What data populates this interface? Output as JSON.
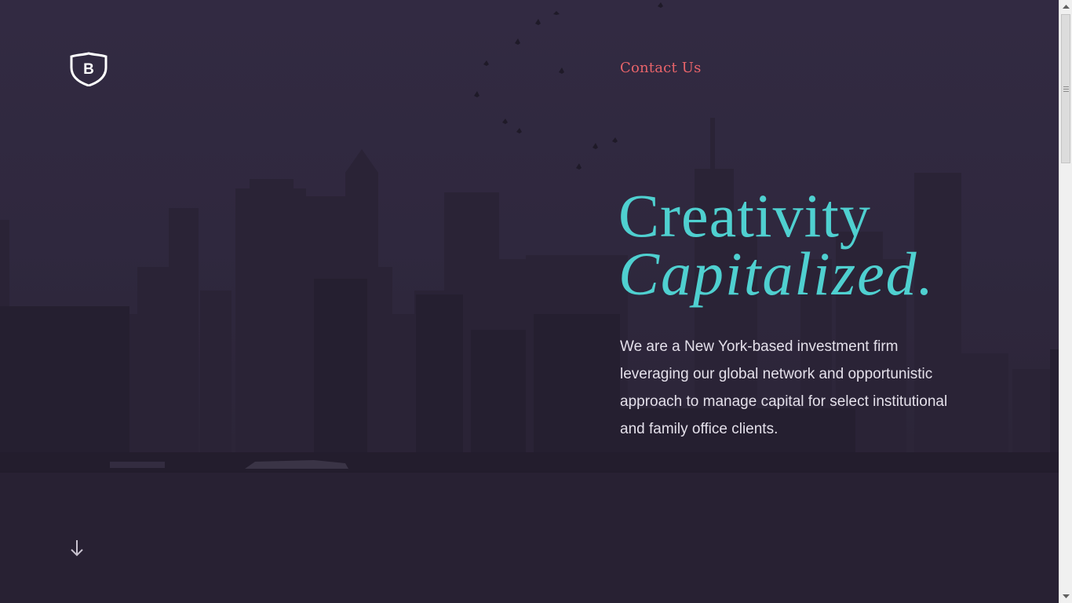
{
  "header": {
    "logo_letter": "B",
    "logo_icon": "shield-logo-icon",
    "contact_label": "Contact Us"
  },
  "hero": {
    "headline_line1": "Creativity",
    "headline_line2": "Capitalized.",
    "intro": "We are a New York-based investment firm leveraging our global network and opportunistic approach to manage capital for select institutional and family office clients."
  },
  "scroll_hint": {
    "icon": "arrow-down-icon"
  },
  "colors": {
    "accent_teal": "#4fd0d0",
    "accent_coral": "#e8646a",
    "background": "#2f283e"
  }
}
